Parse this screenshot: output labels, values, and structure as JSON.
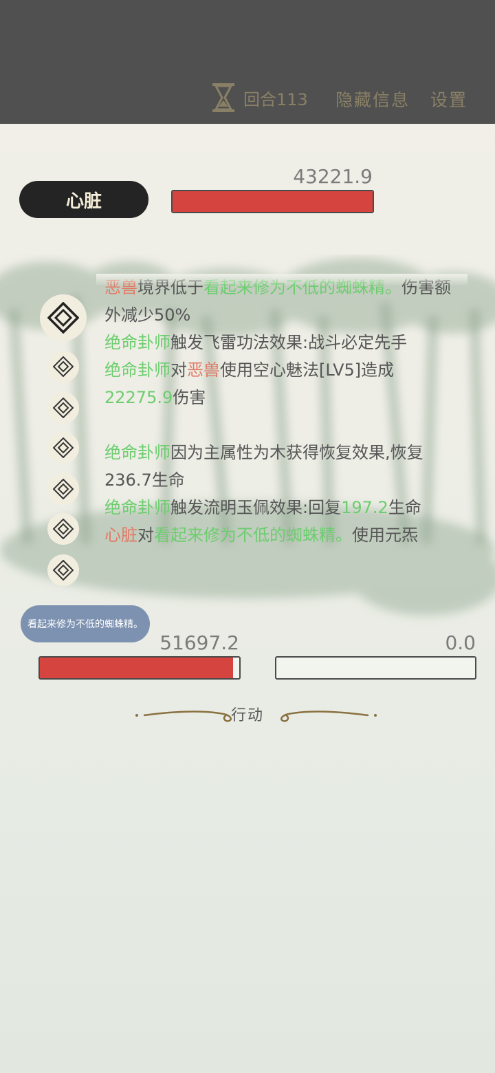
{
  "header": {
    "round_label": "回合113",
    "hide_info_label": "隐藏信息",
    "settings_label": "设置",
    "hourglass_icon": "hourglass-icon"
  },
  "enemy": {
    "name": "心脏",
    "hp_value": "43221.9",
    "hp_ratio": 1.0
  },
  "battle_log": {
    "lines": [
      [
        {
          "t": "恶兽",
          "c": "red"
        },
        {
          "t": "境界低于",
          "c": "dark"
        },
        {
          "t": "看起来修为不低的蜘蛛精。",
          "c": "green"
        },
        {
          "t": "伤害额外减少50%",
          "c": "dark"
        }
      ],
      [
        {
          "t": "绝命卦师",
          "c": "green"
        },
        {
          "t": "触发飞雷功法效果:战斗必定先手",
          "c": "dark"
        }
      ],
      [
        {
          "t": "绝命卦师",
          "c": "green"
        },
        {
          "t": "对",
          "c": "dark"
        },
        {
          "t": "恶兽",
          "c": "red"
        },
        {
          "t": "使用空心魅法[LV5]造成",
          "c": "dark"
        },
        {
          "t": "22275.9",
          "c": "green"
        },
        {
          "t": "伤害",
          "c": "dark"
        }
      ],
      [
        {
          "t": " ",
          "c": "dark"
        }
      ],
      [
        {
          "t": "绝命卦师",
          "c": "green"
        },
        {
          "t": "因为主属性为木获得恢复效果,恢复236.7生命",
          "c": "dark"
        }
      ],
      [
        {
          "t": "绝命卦师",
          "c": "green"
        },
        {
          "t": "触发流明玉佩效果:回复",
          "c": "dark"
        },
        {
          "t": "197.2",
          "c": "green"
        },
        {
          "t": "生命",
          "c": "dark"
        }
      ],
      [
        {
          "t": "心脏",
          "c": "red"
        },
        {
          "t": "对",
          "c": "dark"
        },
        {
          "t": "看起来修为不低的蜘蛛精。",
          "c": "green"
        },
        {
          "t": "使用元炁",
          "c": "dark"
        }
      ]
    ]
  },
  "player": {
    "name_tag": "看起来修为不低的蜘蛛精。",
    "hp_value": "51697.2",
    "hp_ratio": 0.97,
    "mp_value": "0.0",
    "mp_ratio": 0.0
  },
  "action": {
    "label": "行动"
  },
  "colors": {
    "accent_red": "#d64440",
    "log_green": "#6ccd6e",
    "log_red": "#e07a66",
    "topbar": "#505050"
  }
}
